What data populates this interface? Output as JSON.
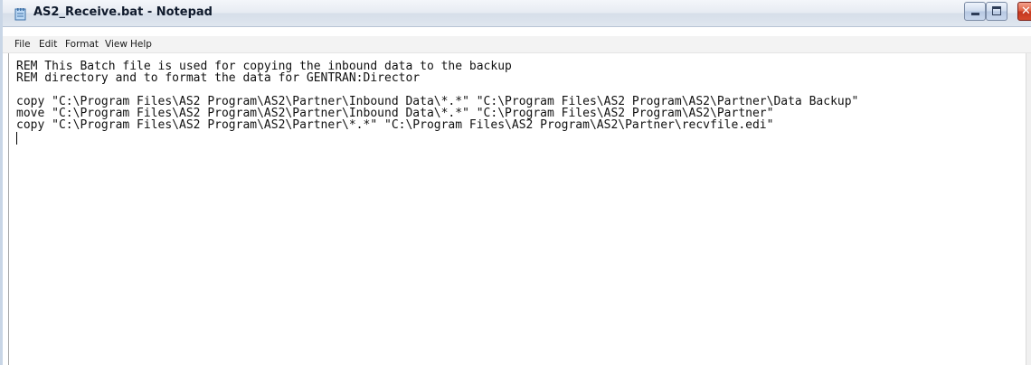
{
  "window": {
    "title": "AS2_Receive.bat - Notepad",
    "app_icon": "notepad-icon",
    "caption_buttons": {
      "minimize_icon": "minimize-icon",
      "maximize_icon": "maximize-icon",
      "close_icon": "close-icon"
    }
  },
  "menu": {
    "items": [
      "File",
      "Edit",
      "Format",
      "View",
      "Help"
    ]
  },
  "editor": {
    "lines": [
      "REM This Batch file is used for copying the inbound data to the backup",
      "REM directory and to format the data for GENTRAN:Director",
      "",
      "copy \"C:\\Program Files\\AS2 Program\\AS2\\Partner\\Inbound Data\\*.*\" \"C:\\Program Files\\AS2 Program\\AS2\\Partner\\Data Backup\"",
      "move \"C:\\Program Files\\AS2 Program\\AS2\\Partner\\Inbound Data\\*.*\" \"C:\\Program Files\\AS2 Program\\AS2\\Partner\"",
      "copy \"C:\\Program Files\\AS2 Program\\AS2\\Partner\\*.*\" \"C:\\Program Files\\AS2 Program\\AS2\\Partner\\recvfile.edi\""
    ]
  },
  "colors": {
    "close_button": "#d54a2c",
    "title_text": "#0f1a2c"
  }
}
